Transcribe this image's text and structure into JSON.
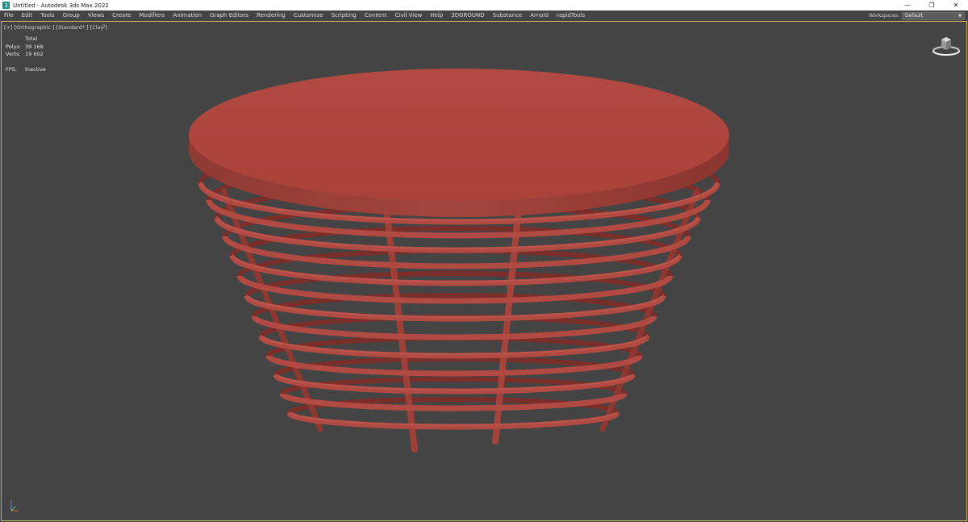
{
  "window": {
    "title": "Untitled - Autodesk 3ds Max 2022",
    "controls": {
      "minimize": "—",
      "restore": "❐",
      "close": "✕"
    }
  },
  "menu": {
    "items": [
      "File",
      "Edit",
      "Tools",
      "Group",
      "Views",
      "Create",
      "Modifiers",
      "Animation",
      "Graph Editors",
      "Rendering",
      "Customize",
      "Scripting",
      "Content",
      "Civil View",
      "Help",
      "3DGROUND",
      "Substance",
      "Arnold",
      "rapidTools"
    ]
  },
  "workspaces": {
    "label": "Workspaces:",
    "value": "Default"
  },
  "viewport": {
    "label": "[+] [Orthographic ] [Standard* ] [Clay ]",
    "filter_icon": "filter-icon",
    "stats": {
      "header": "Total",
      "polys_label": "Polys:",
      "polys_value": "39 168",
      "verts_label": "Verts:",
      "verts_value": "19 602",
      "fps_label": "FPS:",
      "fps_value": "Inactive"
    },
    "model_color": "#b04a42",
    "background_color": "#444444"
  }
}
